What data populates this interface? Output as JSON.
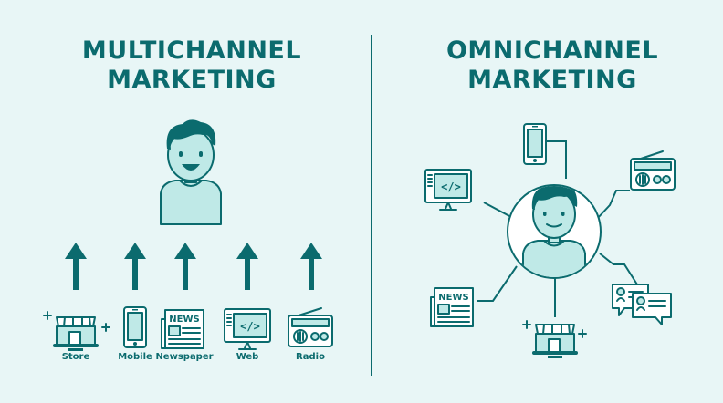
{
  "left": {
    "title_line1": "MULTICHANNEL",
    "title_line2": "MARKETING",
    "channels": [
      "Store",
      "Mobile",
      "Newspaper",
      "Web",
      "Radio"
    ]
  },
  "right": {
    "title_line1": "OMNICHANNEL",
    "title_line2": "MARKETING"
  },
  "icons": {
    "newspaper_text": "NEWS",
    "web_code": "</>"
  },
  "colors": {
    "background": "#e8f6f6",
    "primary": "#0b6b6e",
    "fill_light": "#bfe9e7"
  }
}
